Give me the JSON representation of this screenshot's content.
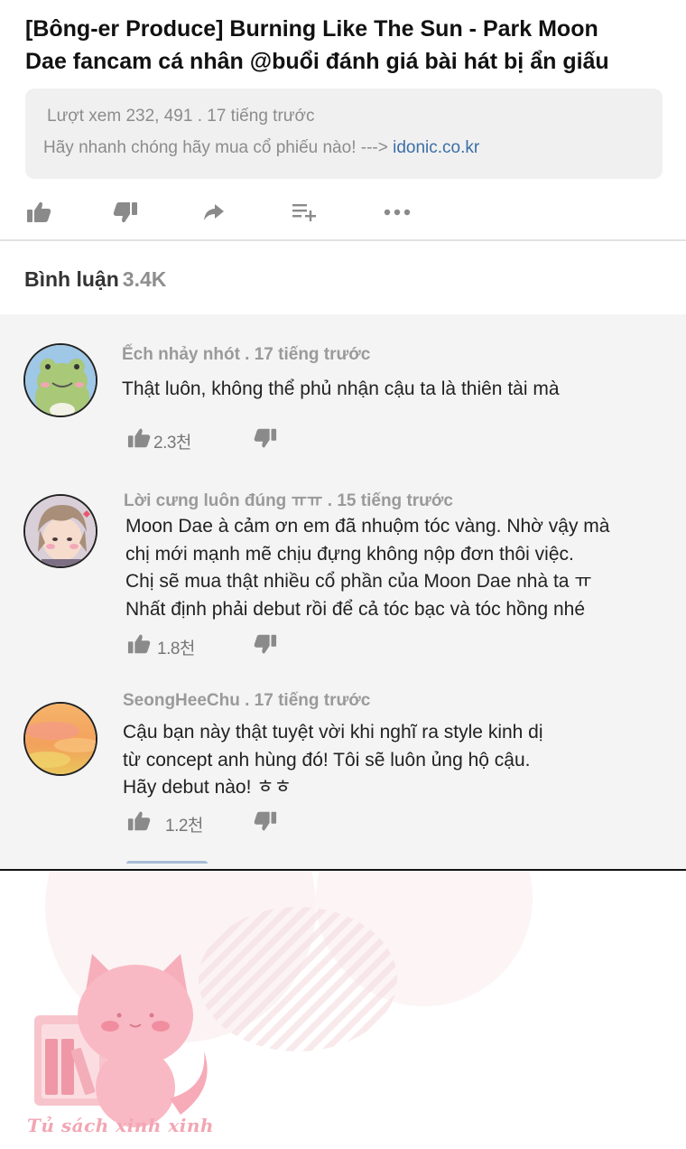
{
  "video": {
    "title_line1": "[Bông-er Produce] Burning Like The Sun - Park Moon",
    "title_line2": "Dae fancam cá nhân @buổi đánh giá bài hát bị ẩn giấu",
    "meta": "Lượt xem 232, 491 . 17 tiếng trước",
    "promo_text": "Hãy nhanh chóng hãy mua cổ phiếu nào! ---> ",
    "promo_link": "idonic.co.kr"
  },
  "actions": {
    "items": [
      {
        "name": "like-icon",
        "icon": "thumbs-up"
      },
      {
        "name": "dislike-icon",
        "icon": "thumbs-down"
      },
      {
        "name": "share-icon",
        "icon": "share-arrow"
      },
      {
        "name": "add-to-playlist-icon",
        "icon": "playlist-add"
      },
      {
        "name": "more-icon",
        "icon": "ellipsis"
      }
    ],
    "icon_color": "#8a8a8a"
  },
  "comments_section": {
    "label": "Bình luận",
    "count": "3.4K",
    "panel_color": "#f4f4f4",
    "comments": [
      {
        "author": "Ếch nhảy nhót . 17 tiếng trước",
        "avatar": "frog-avatar",
        "lines": [
          "Thật luôn, không thể phủ nhận cậu ta là thiên tài mà"
        ],
        "likes": "2.3천"
      },
      {
        "author": "Lời cưng luôn đúng ㅠㅠ . 15 tiếng trước",
        "avatar": "idol-avatar",
        "lines": [
          "Moon Dae à cảm ơn em đã nhuộm tóc vàng. Nhờ vậy mà",
          "chị mới mạnh mẽ chịu đựng không nộp đơn thôi việc.",
          "Chị sẽ mua thật nhiều cổ phần của Moon Dae nhà ta ㅠ",
          "Nhất định phải debut rồi để cả tóc bạc và tóc hồng nhé"
        ],
        "likes": "1.8천"
      },
      {
        "author": "SeongHeeChu . 17 tiếng trước",
        "avatar": "sunset-avatar",
        "lines": [
          "Cậu bạn này thật tuyệt vời khi nghĩ ra style kinh dị",
          "từ concept anh hùng đó! Tôi sẽ luôn ủng hộ cậu.",
          "Hãy debut nào! ㅎㅎ"
        ],
        "likes": "1.2천"
      }
    ]
  },
  "watermark": {
    "text": "Tủ sách xinh xinh",
    "logo": "pink-cat-bookshelf-logo",
    "accent": "#f2a6b4"
  }
}
